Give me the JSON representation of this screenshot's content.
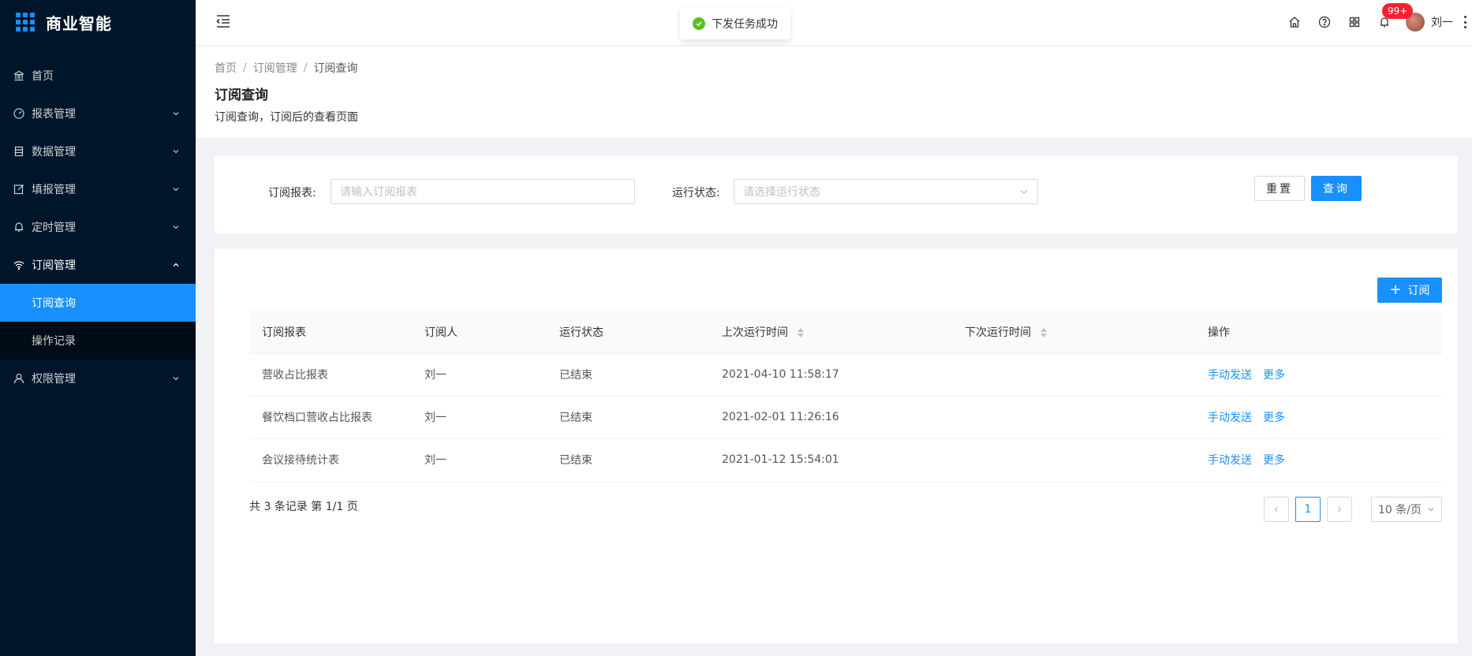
{
  "app": {
    "title": "商业智能"
  },
  "sidebar": {
    "items": [
      {
        "label": "首页",
        "icon": "bank-icon"
      },
      {
        "label": "报表管理",
        "icon": "dashboard-icon"
      },
      {
        "label": "数据管理",
        "icon": "database-icon"
      },
      {
        "label": "填报管理",
        "icon": "form-icon"
      },
      {
        "label": "定时管理",
        "icon": "bell-icon"
      },
      {
        "label": "订阅管理",
        "icon": "wifi-icon"
      },
      {
        "label": "权限管理",
        "icon": "user-icon"
      }
    ],
    "submenu": [
      {
        "label": "订阅查询",
        "active": true
      },
      {
        "label": "操作记录",
        "active": false
      }
    ]
  },
  "header": {
    "toast": "下发任务成功",
    "badge": "99+",
    "user_name": "刘一"
  },
  "breadcrumb": [
    "首页",
    "订阅管理",
    "订阅查询"
  ],
  "page": {
    "title": "订阅查询",
    "description": "订阅查询，订阅后的查看页面"
  },
  "filter": {
    "report_label": "订阅报表:",
    "report_placeholder": "请输入订阅报表",
    "status_label": "运行状态:",
    "status_placeholder": "请选择运行状态",
    "reset_label": "重置",
    "query_label": "查询"
  },
  "table": {
    "add_label": "订阅",
    "columns": [
      "订阅报表",
      "订阅人",
      "运行状态",
      "上次运行时间",
      "下次运行时间",
      "操作"
    ],
    "rows": [
      {
        "report": "营收占比报表",
        "subscriber": "刘一",
        "status": "已结束",
        "last_run": "2021-04-10 11:58:17",
        "next_run": "",
        "action_send": "手动发送",
        "action_more": "更多"
      },
      {
        "report": "餐饮档口营收占比报表",
        "subscriber": "刘一",
        "status": "已结束",
        "last_run": "2021-02-01 11:26:16",
        "next_run": "",
        "action_send": "手动发送",
        "action_more": "更多"
      },
      {
        "report": "会议接待统计表",
        "subscriber": "刘一",
        "status": "已结束",
        "last_run": "2021-01-12 15:54:01",
        "next_run": "",
        "action_send": "手动发送",
        "action_more": "更多"
      }
    ],
    "summary": "共 3 条记录 第 1/1 页"
  },
  "pagination": {
    "current": "1",
    "page_size": "10 条/页"
  },
  "colors": {
    "sidebar_bg": "#001529",
    "submenu_bg": "#000c17",
    "primary": "#1890ff",
    "success": "#52c41a",
    "badge": "#f5222d"
  }
}
